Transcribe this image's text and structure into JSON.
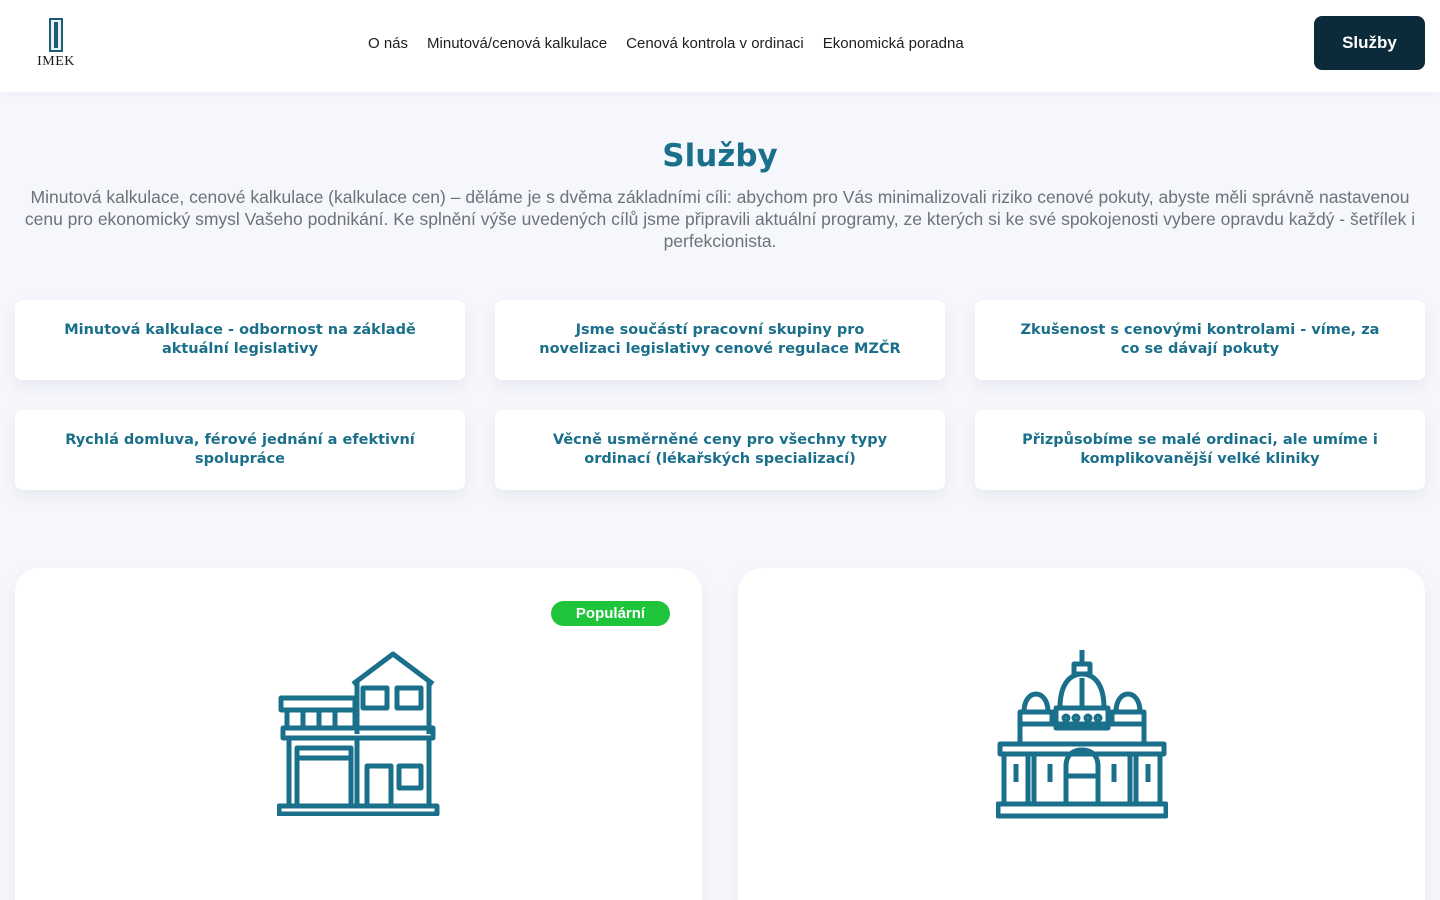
{
  "header": {
    "logo_text": "IMEK",
    "nav": [
      "O nás",
      "Minutová/cenová kalkulace",
      "Cenová kontrola v ordinaci",
      "Ekonomická poradna"
    ],
    "cta_label": "Služby"
  },
  "hero": {
    "title": "Služby",
    "lead": "Minutová kalkulace, cenové kalkulace (kalkulace cen) – děláme je s dvěma základními cíli: abychom pro Vás minimalizovali riziko cenové pokuty, abyste měli správně nastavenou cenu pro ekonomický smysl Vašeho podnikání. Ke splnění výše uvedených cílů jsme připravili aktuální programy, ze kterých si ke své spokojenosti vybere opravdu každý - šetřílek i perfekcionista."
  },
  "features": [
    "Minutová kalkulace - odbornost na základě aktuální legislativy",
    "Jsme součástí pracovní skupiny pro novelizaci legislativy cenové regulace MZČR",
    "Zkušenost s cenovými kontrolami - víme, za co se dávají pokuty",
    "Rychlá domluva, férové jednání a efektivní spolupráce",
    "Věcně usměrněné ceny pro všechny typy ordinací (lékařských specializací)",
    "Přizpůsobíme se malé ordinaci, ale umíme i komplikovanější velké kliniky"
  ],
  "services": [
    {
      "badge": "Populární",
      "icon": "house-icon"
    },
    {
      "icon": "palace-icon"
    }
  ],
  "colors": {
    "accent": "#1a6f8a",
    "dark": "#0c2b3a",
    "badge": "#1ec43a"
  }
}
